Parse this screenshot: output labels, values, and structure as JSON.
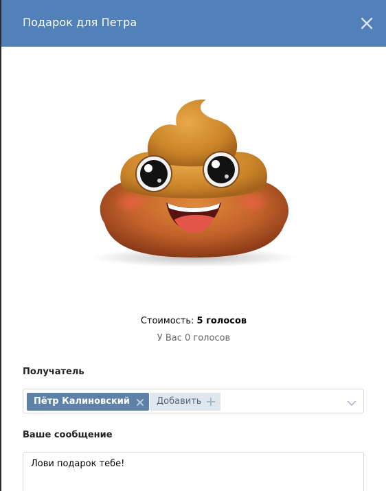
{
  "modal": {
    "title": "Подарок для Петра",
    "close_icon": "close-icon"
  },
  "gift": {
    "image_icon": "poop-emoji-icon",
    "price_prefix": "Стоимость: ",
    "price_value": "5 голосов",
    "balance": "У Вас 0 голосов"
  },
  "recipient": {
    "label": "Получатель",
    "selected": "Пётр Калиновский",
    "add_label": "Добавить",
    "dropdown_icon": "chevron-down-icon"
  },
  "message": {
    "label": "Ваше сообщение",
    "value": "Лови подарок тебе!"
  },
  "colors": {
    "header": "#5181b8",
    "token": "#5e81a8",
    "add_button": "#dfe6ed",
    "border": "#d3d9de"
  }
}
